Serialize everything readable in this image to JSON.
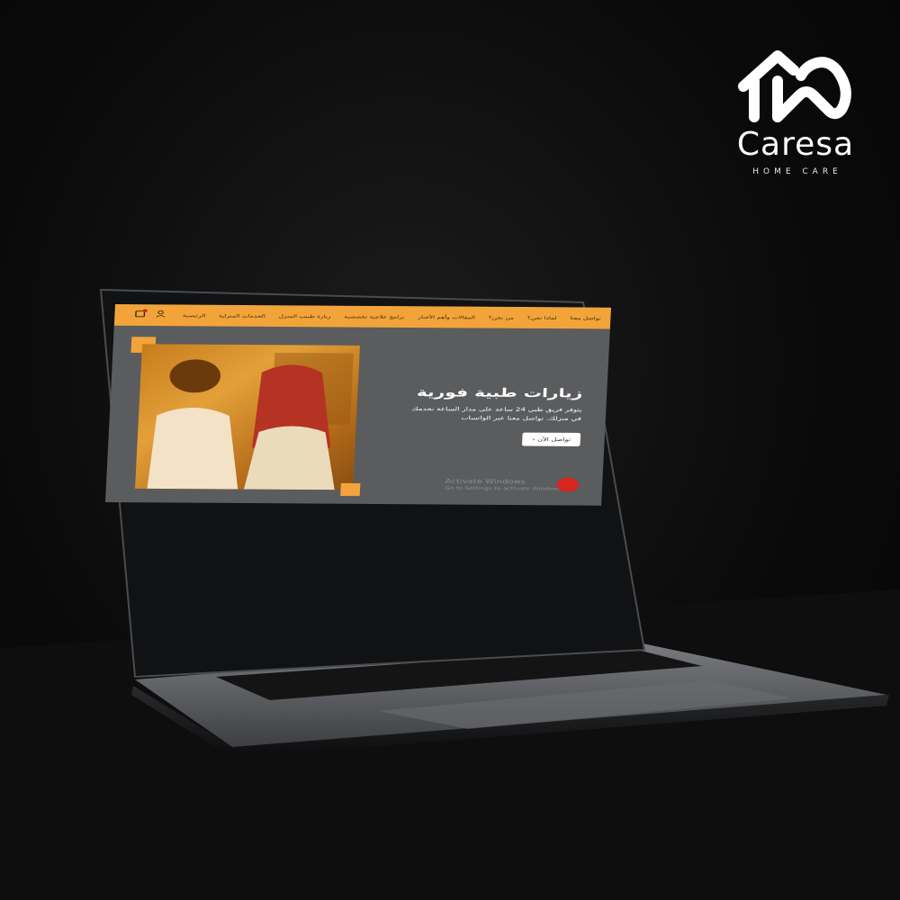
{
  "brand": {
    "name": "Caresa",
    "tagline": "HOME CARE"
  },
  "site": {
    "nav": {
      "items": [
        "الرئيسية",
        "الخدمات المنزلية",
        "زيارة طبيب المنزل",
        "برامج علاجية تخصصية",
        "المقالات وأهم الأخبار",
        "من نحن؟",
        "لماذا نحن؟",
        "تواصل معنا"
      ]
    },
    "hero": {
      "title": "زيارات طبية فورية",
      "description": "يتوفر فريق طبي 24 ساعة على مدار الساعة نخدمك في منزلك. تواصل معنا عبر الواتساب",
      "button_label": "تواصل الآن"
    },
    "overlay": {
      "activate_title": "Activate Windows",
      "activate_sub": "Go to Settings to activate Windows"
    }
  },
  "colors": {
    "accent": "#f2a43a",
    "screen_bg": "#5b5c5e",
    "chat": "#d6261d"
  }
}
